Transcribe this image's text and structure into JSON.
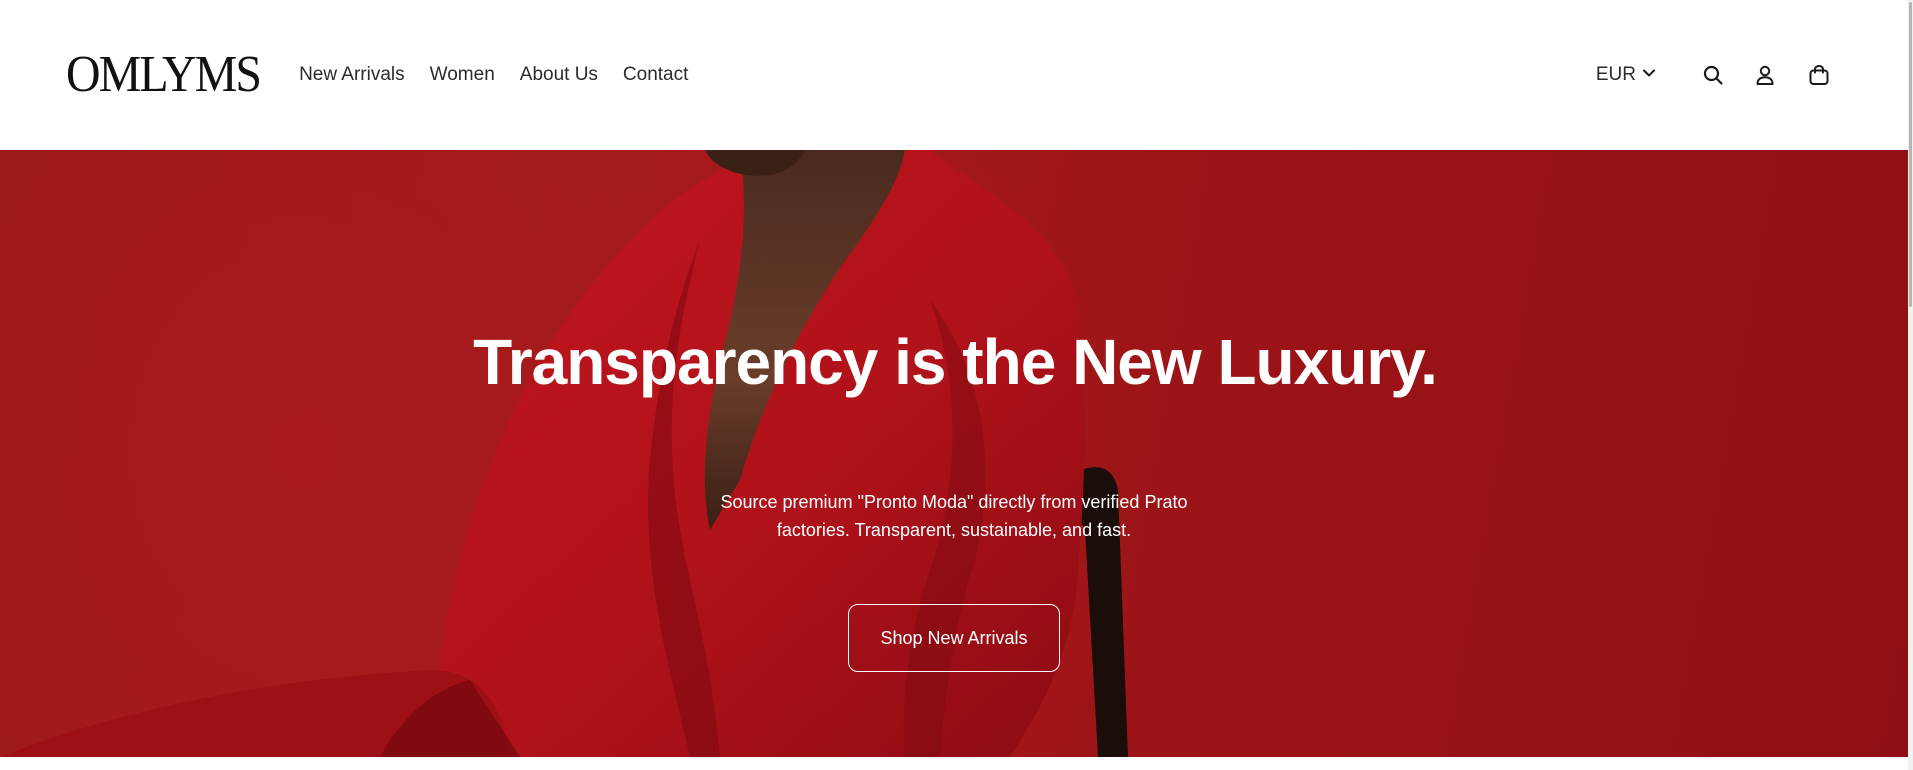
{
  "brand": {
    "logo_text": "OMLYMS"
  },
  "nav": {
    "items": [
      {
        "label": "New Arrivals"
      },
      {
        "label": "Women"
      },
      {
        "label": "About Us"
      },
      {
        "label": "Contact"
      }
    ]
  },
  "header_actions": {
    "currency": "EUR",
    "icons": [
      "chevron-down-icon",
      "search-icon",
      "account-icon",
      "shopping-bag-icon"
    ]
  },
  "hero": {
    "title": "Transparency is the New Luxury.",
    "subtitle": "Source premium \"Pronto Moda\" directly from verified Prato factories. Transparent, sustainable, and fast.",
    "cta_label": "Shop New Arrivals"
  },
  "colors": {
    "hero_background": "#a0191b",
    "text_on_hero": "#ffffff",
    "header_background": "#ffffff",
    "header_text": "#2b2b2b"
  }
}
